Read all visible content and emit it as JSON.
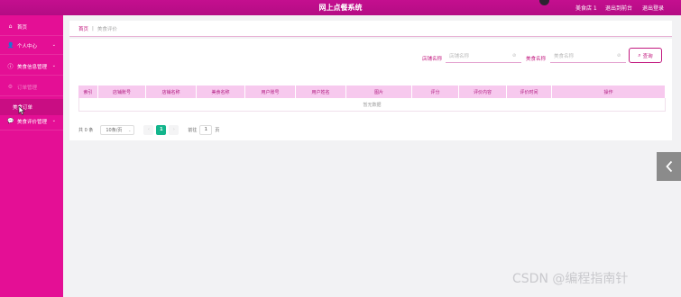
{
  "header": {
    "title": "网上点餐系统",
    "user": "美食店 1",
    "backend_link": "退出到前台",
    "logout_link": "退出登录"
  },
  "sidebar": {
    "items": [
      {
        "icon": "home-icon",
        "label": "首页"
      },
      {
        "icon": "user-icon",
        "label": "个人中心"
      },
      {
        "icon": "info-icon",
        "label": "美食信息管理"
      },
      {
        "icon": "gear-icon",
        "label": "订单管理"
      },
      {
        "icon": "chat-icon",
        "label": "美食评价管理"
      }
    ],
    "submenu_label": "美食订单"
  },
  "breadcrumb": {
    "home": "首页",
    "separator": "|",
    "current": "美食评价"
  },
  "search": {
    "shop_name_label": "店铺名称",
    "shop_name_placeholder": "店铺名称",
    "food_name_label": "美食名称",
    "food_name_placeholder": "美食名称",
    "query_button": "查询"
  },
  "table": {
    "columns": [
      "索引",
      "店铺账号",
      "店铺名称",
      "美食名称",
      "用户账号",
      "用户姓名",
      "图片",
      "评分",
      "评价内容",
      "评价时间",
      "操作"
    ],
    "empty_text": "暂无数据"
  },
  "pagination": {
    "total": "共 0 条",
    "page_size": "10条/页",
    "current_page": "1",
    "goto_prefix": "前往",
    "goto_value": "1",
    "goto_suffix": "页"
  },
  "watermark": "CSDN @编程指南针",
  "colors": {
    "sidebar": "#e40f95",
    "topbar": "#c40f8f",
    "accent": "#c2187f",
    "table_header": "#f7c9ee",
    "active_page": "#13b58c"
  }
}
